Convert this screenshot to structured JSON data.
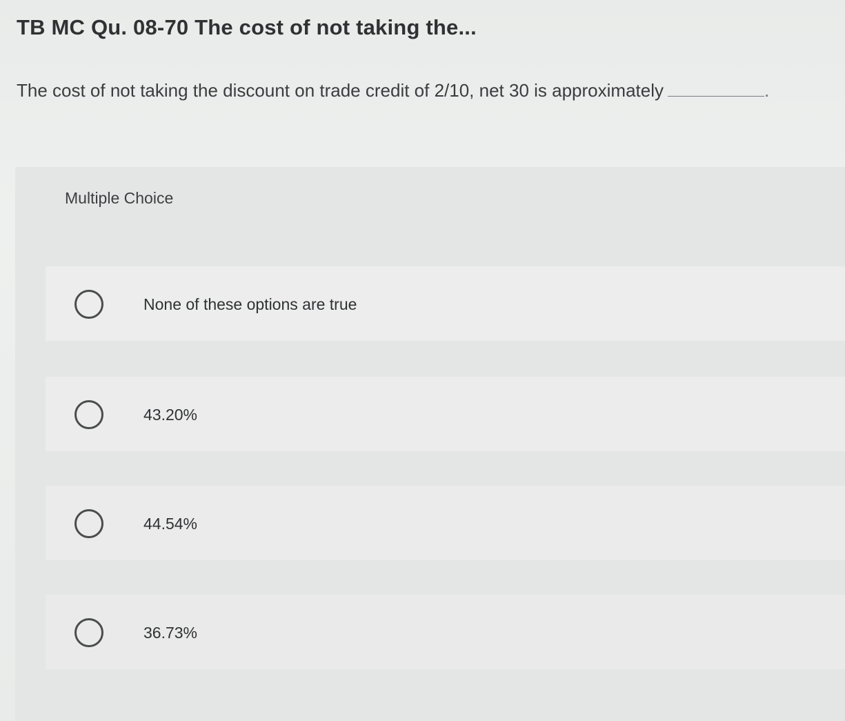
{
  "question": {
    "title": "TB MC Qu. 08-70 The cost of not taking the...",
    "prompt": "The cost of not taking the discount on trade credit of 2/10, net 30 is approximately",
    "prompt_end": "."
  },
  "multiple_choice": {
    "header": "Multiple Choice",
    "options": [
      {
        "label": "None of these options are true"
      },
      {
        "label": "43.20%"
      },
      {
        "label": "44.54%"
      },
      {
        "label": "36.73%"
      }
    ]
  },
  "colors": {
    "background": "#eceeed",
    "panel": "#e3e6e5",
    "text": "#2f3133",
    "radio_border": "#4a4c4e"
  },
  "icons": {
    "radio": "radio-unchecked-icon"
  }
}
